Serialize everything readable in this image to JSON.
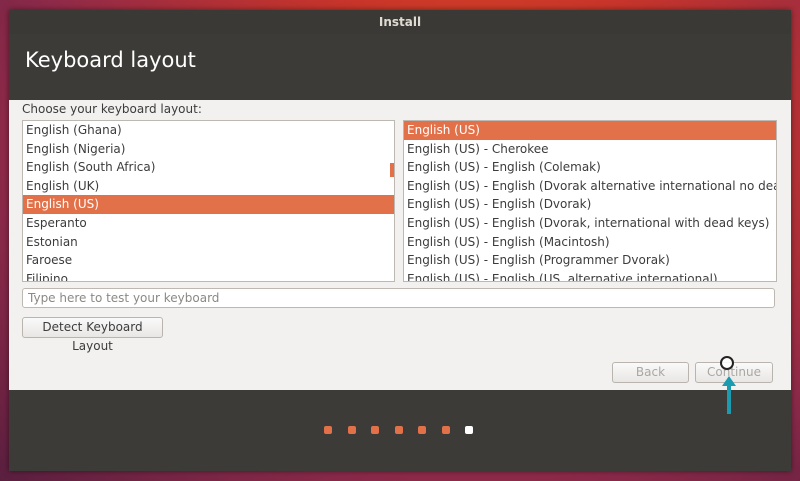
{
  "window": {
    "title": "Install"
  },
  "header": {
    "title": "Keyboard layout"
  },
  "prompt": "Choose your keyboard layout:",
  "layouts": [
    {
      "label": "English (Ghana)",
      "selected": false
    },
    {
      "label": "English (Nigeria)",
      "selected": false
    },
    {
      "label": "English (South Africa)",
      "selected": false
    },
    {
      "label": "English (UK)",
      "selected": false
    },
    {
      "label": "English (US)",
      "selected": true
    },
    {
      "label": "Esperanto",
      "selected": false
    },
    {
      "label": "Estonian",
      "selected": false
    },
    {
      "label": "Faroese",
      "selected": false
    },
    {
      "label": "Filipino",
      "selected": false
    }
  ],
  "variants": [
    {
      "label": "English (US)",
      "selected": true
    },
    {
      "label": "English (US) - Cherokee",
      "selected": false
    },
    {
      "label": "English (US) - English (Colemak)",
      "selected": false
    },
    {
      "label": "English (US) - English (Dvorak alternative international no dead keys)",
      "selected": false
    },
    {
      "label": "English (US) - English (Dvorak)",
      "selected": false
    },
    {
      "label": "English (US) - English (Dvorak, international with dead keys)",
      "selected": false
    },
    {
      "label": "English (US) - English (Macintosh)",
      "selected": false
    },
    {
      "label": "English (US) - English (Programmer Dvorak)",
      "selected": false
    },
    {
      "label": "English (US) - English (US, alternative international)",
      "selected": false
    }
  ],
  "test_input": {
    "placeholder": "Type here to test your keyboard",
    "value": ""
  },
  "buttons": {
    "detect": "Detect Keyboard Layout",
    "back": "Back",
    "continue": "Continue"
  },
  "progress": {
    "total_steps": 7,
    "current_step": 7
  },
  "colors": {
    "accent": "#e2714a",
    "header_bg": "#3c3b37",
    "content_bg": "#f2f1f0"
  }
}
